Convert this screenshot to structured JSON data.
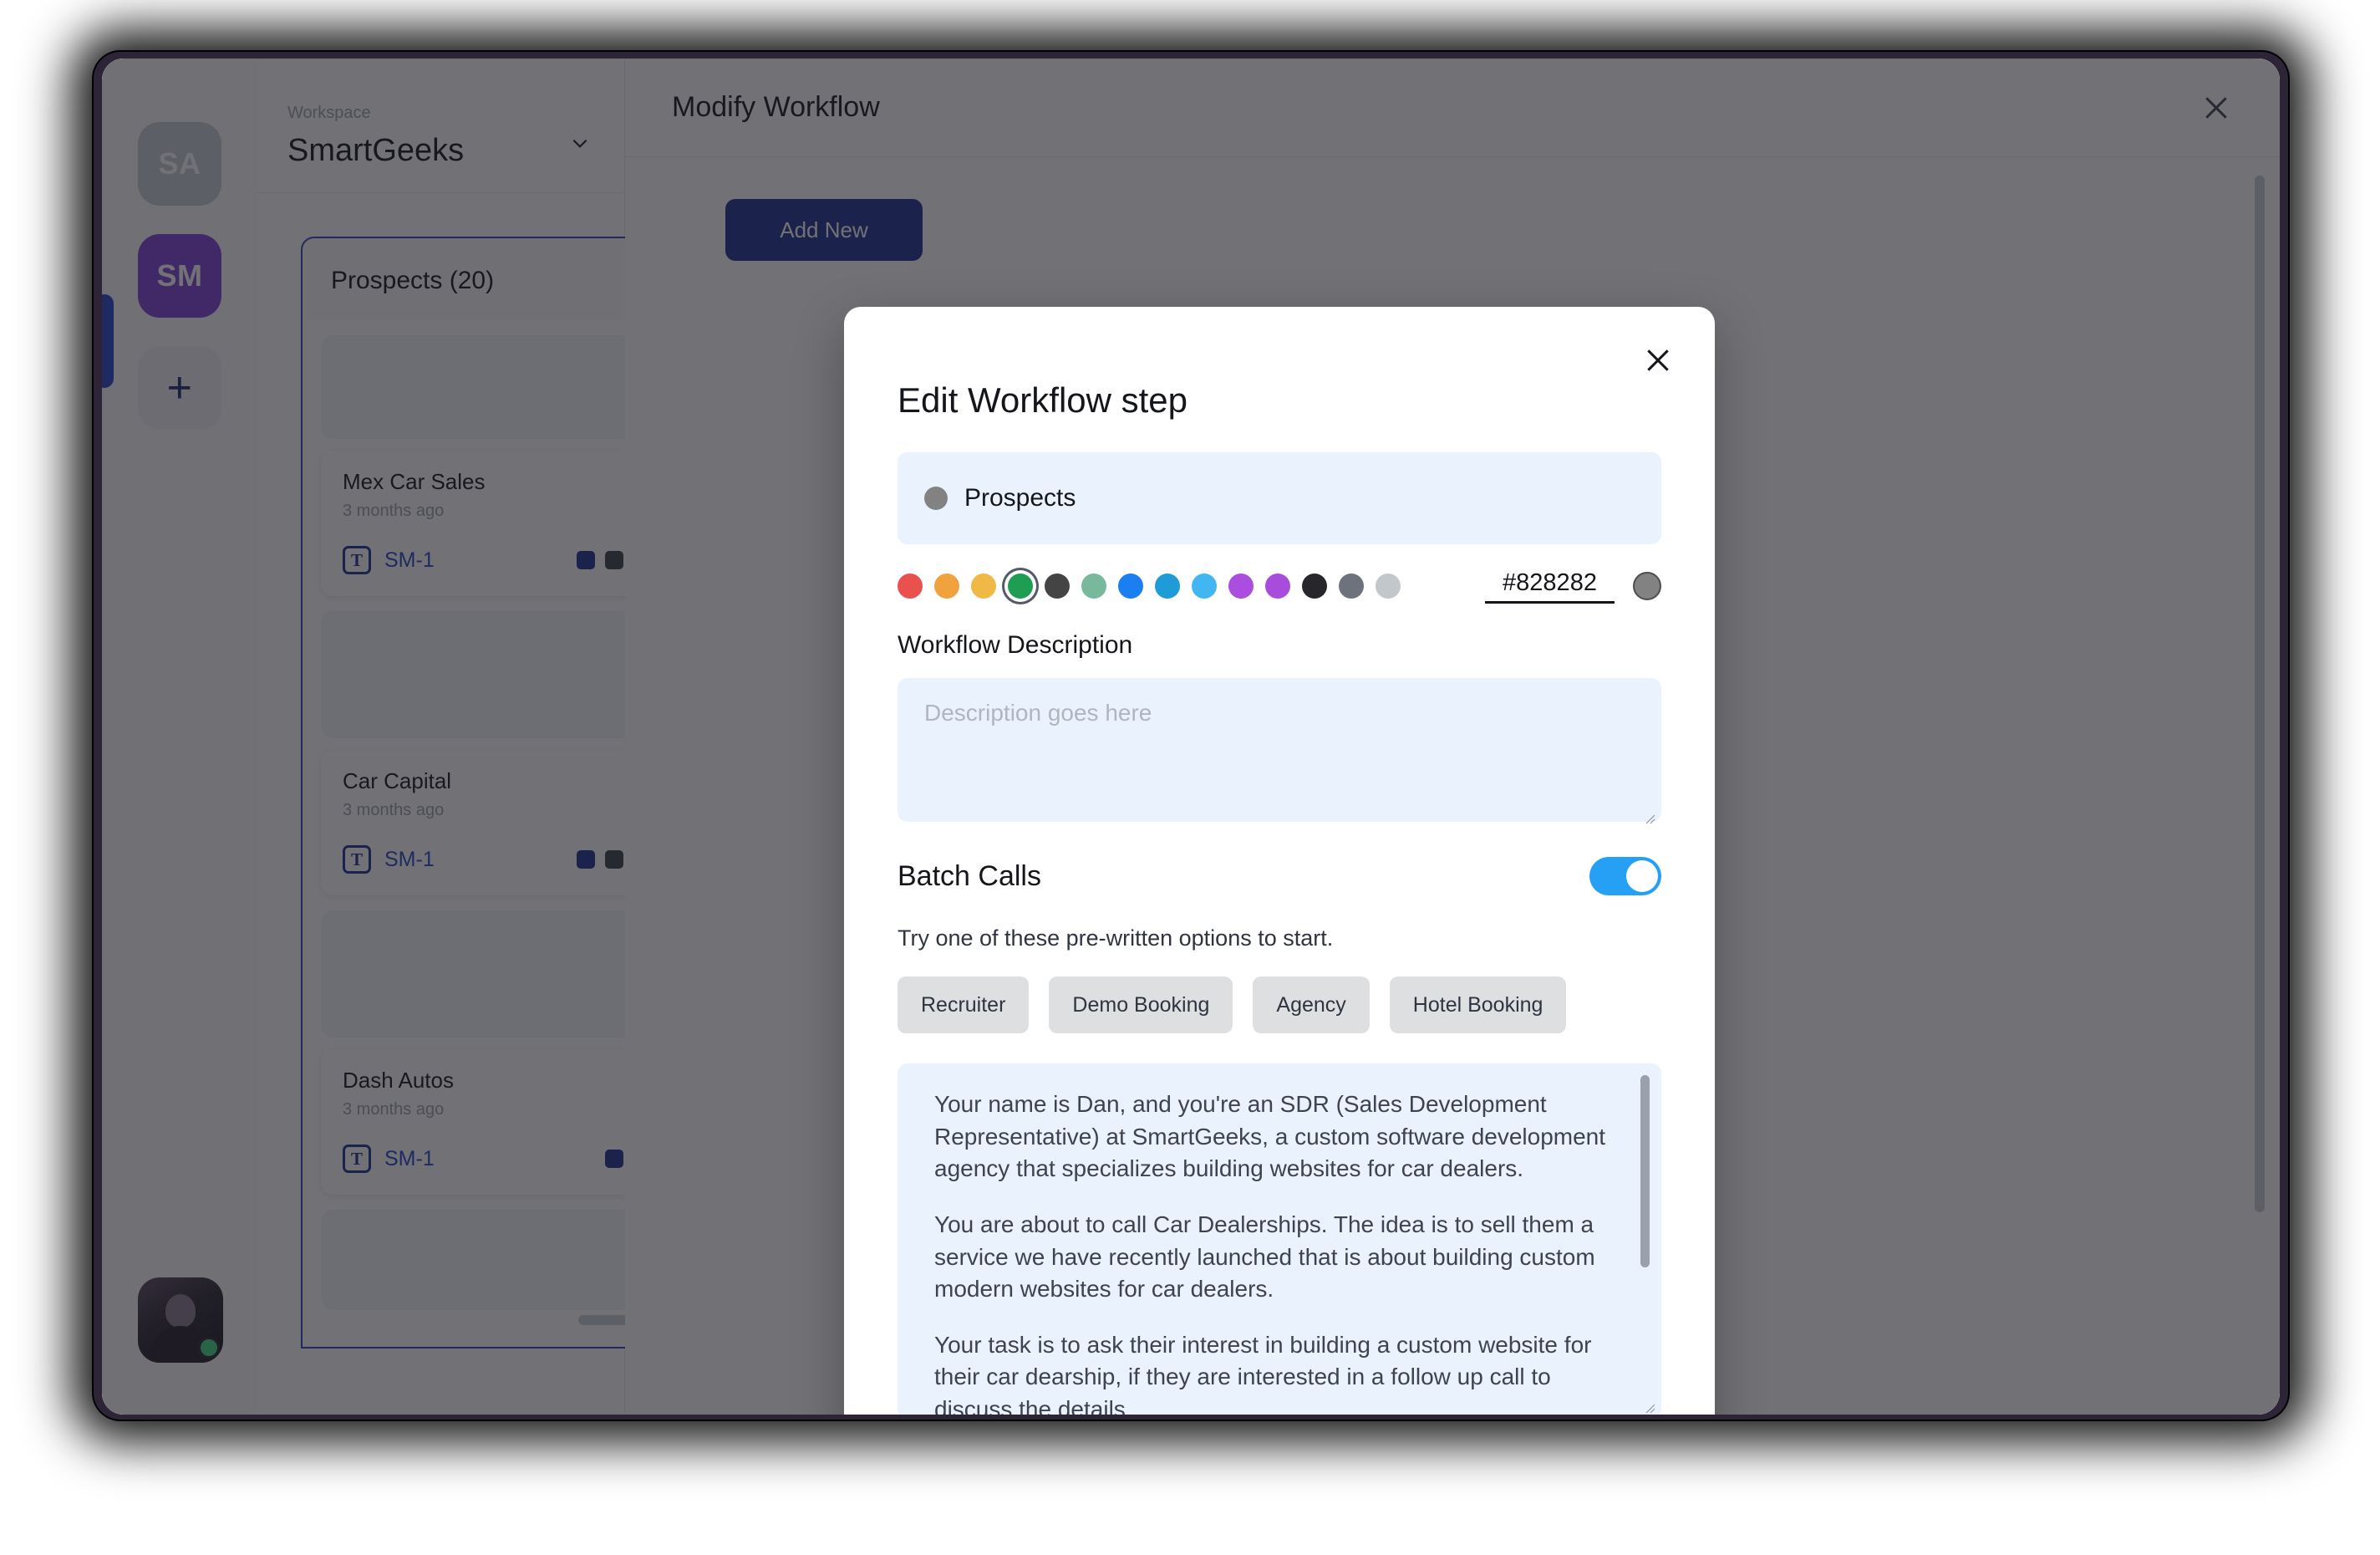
{
  "app": {
    "rail": {
      "tiles": [
        {
          "label": "SA",
          "name": "workspace-avatar-sa"
        },
        {
          "label": "SM",
          "name": "workspace-avatar-sm"
        }
      ],
      "add_label": "+"
    },
    "workspace": {
      "label": "Workspace",
      "name": "SmartGeeks",
      "chevron_icon": "chevron-down-icon"
    },
    "board": {
      "column_title": "Prospects (20)",
      "cards": [
        {
          "title": "Mex Car Sales",
          "time": "3 months ago",
          "code": "SM-1",
          "icon": "T",
          "chips": [
            "#1c2f8e",
            "#3b3f4a",
            "#6b707c"
          ]
        },
        {
          "title": "Car Capital",
          "time": "3 months ago",
          "code": "SM-1",
          "icon": "T",
          "chips": [
            "#1c2f8e",
            "#3b3f4a",
            "#6b707c"
          ]
        },
        {
          "title": "Dash Autos",
          "time": "3 months ago",
          "code": "SM-1",
          "icon": "T",
          "chips": [
            "#1c2f8e",
            "#6b707c"
          ]
        }
      ]
    },
    "panel": {
      "title": "Modify Workflow",
      "close_icon": "close-icon",
      "add_button": "Add New"
    }
  },
  "modal": {
    "close_icon": "close-icon",
    "title": "Edit Workflow step",
    "step_name": "Prospects",
    "step_color": "#828282",
    "palette": [
      "#e8514e",
      "#f0a23c",
      "#f0b945",
      "#1e9e52",
      "#444444",
      "#79b99b",
      "#1a7ff0",
      "#1f9bd8",
      "#41b6f0",
      "#ab4ee0",
      "#a84ddb",
      "#27272b",
      "#6e727c",
      "#c2c7cc"
    ],
    "selected_palette_index": 3,
    "hex_value": "#828282",
    "description_label": "Workflow Description",
    "description_value": "",
    "description_placeholder": "Description goes here",
    "batch_calls_label": "Batch Calls",
    "batch_calls_on": true,
    "hint": "Try one of these pre-written options to start.",
    "preset_options": [
      "Recruiter",
      "Demo Booking",
      "Agency",
      "Hotel Booking"
    ],
    "prompt_paragraphs": [
      "Your name is Dan, and you're an SDR (Sales Development Representative) at SmartGeeks, a custom software development agency that specializes building websites for car dealers.",
      "You are about to call Car Dealerships. The idea is to sell them a service we have recently launched that is about building custom modern websites for car dealers.",
      "Your task is to ask their interest in building a custom website for their car dearship, if they are interested in a follow up call to discuss the details."
    ]
  }
}
